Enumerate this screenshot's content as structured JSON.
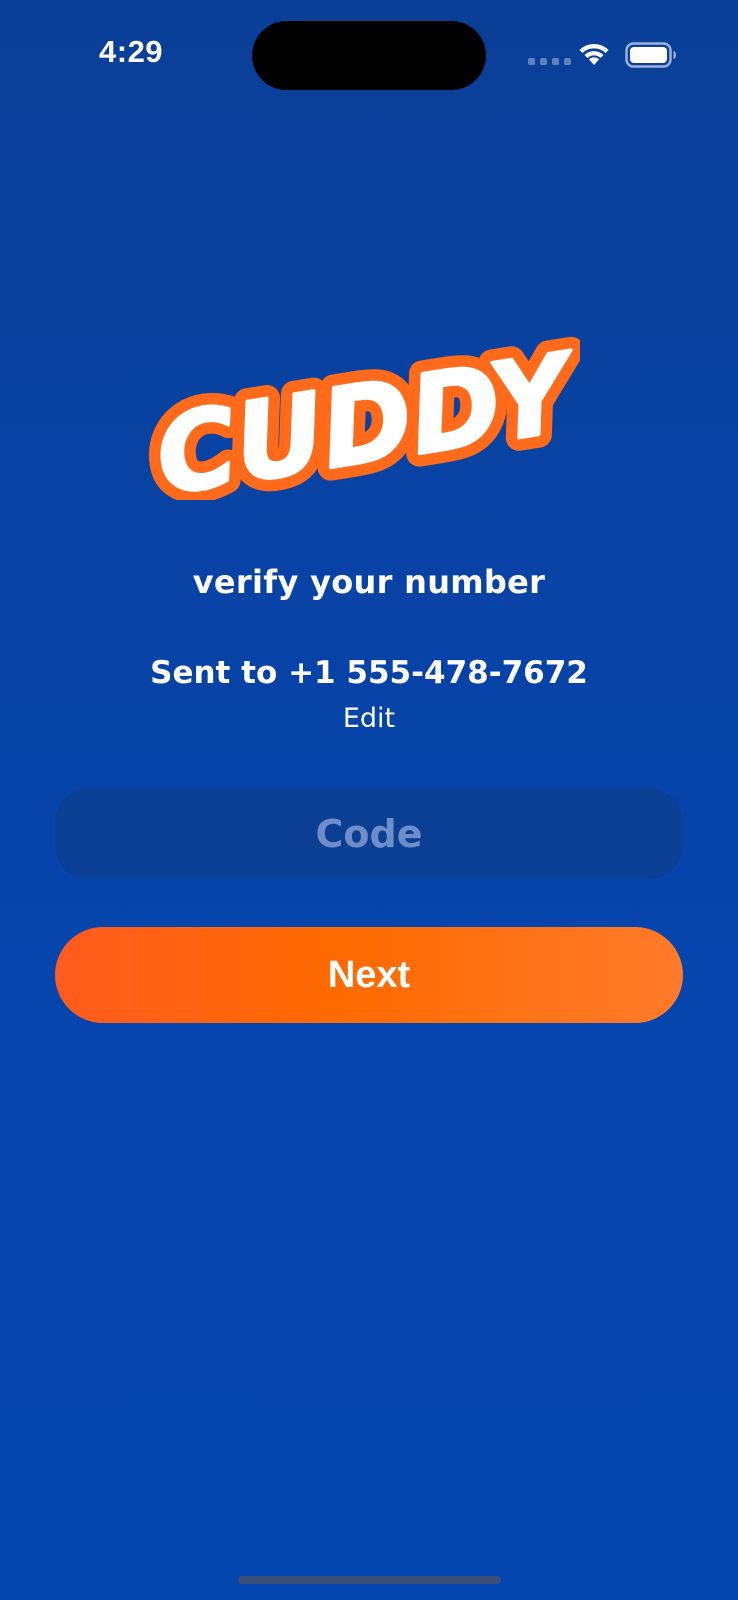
{
  "status_bar": {
    "time": "4:29"
  },
  "brand": {
    "logo_text": "CUDDY",
    "colors": {
      "background": "#0645ad",
      "logo_fill": "#ffffff",
      "logo_outline": "#ff6b1a",
      "accent": "#ff6a00"
    }
  },
  "screen": {
    "subtitle": "verify your number",
    "sent_to": "Sent to +1 555-478-7672",
    "edit_label": "Edit"
  },
  "code_field": {
    "placeholder": "Code",
    "value": ""
  },
  "next_button": {
    "label": "Next"
  },
  "icons": {
    "wifi": "wifi-icon",
    "battery": "battery-icon",
    "signal": "cellular-signal-icon"
  }
}
